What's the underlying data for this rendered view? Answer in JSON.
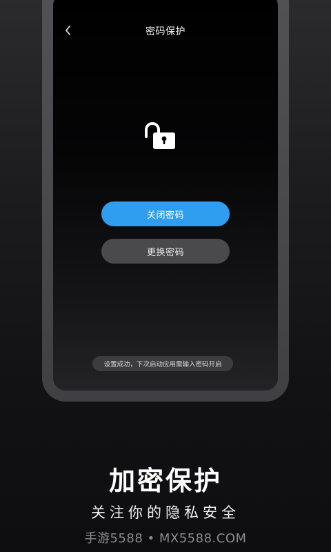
{
  "app": {
    "title": "密码保护"
  },
  "actions": {
    "close_password": "关闭密码",
    "change_password": "更换密码"
  },
  "toast": {
    "message": "设置成功，下次启动应用需输入密码开启"
  },
  "promo": {
    "headline": "加密保护",
    "subtitle": "关注你的隐私安全",
    "watermark": "手游5588 • MX5588.COM"
  },
  "colors": {
    "primary_button": "#2f9ef0",
    "secondary_button": "#4a4a4c",
    "toast_bg": "#3c3c3e"
  },
  "icons": {
    "back": "chevron-left-icon",
    "lock": "unlocked-padlock-icon"
  }
}
